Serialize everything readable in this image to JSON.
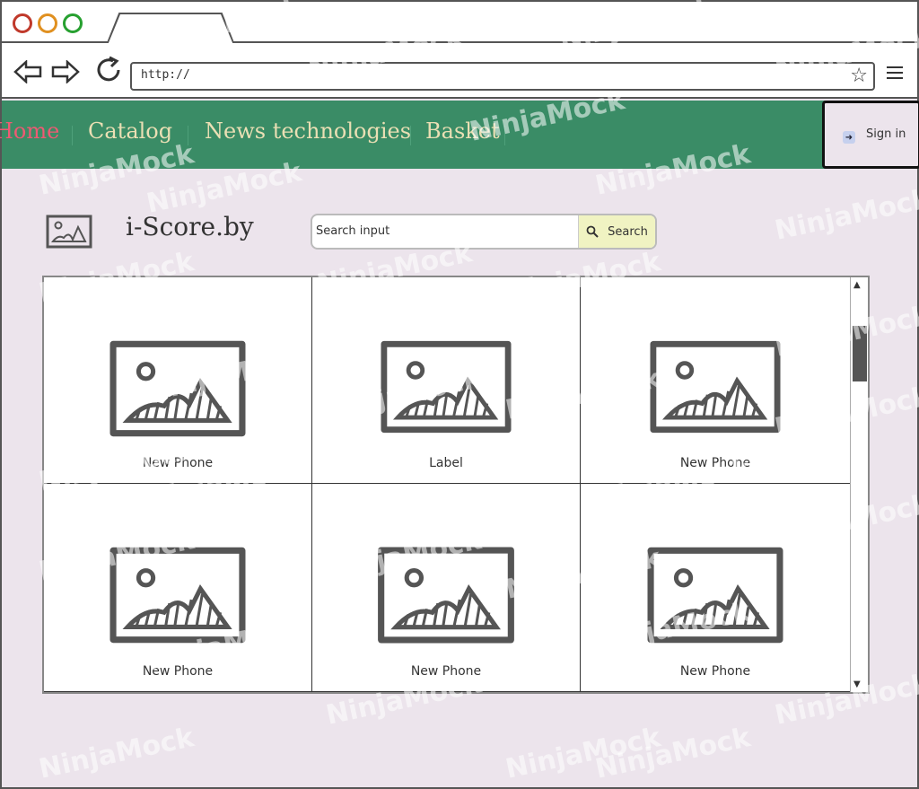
{
  "browser": {
    "url": "http://"
  },
  "site": {
    "nav": [
      {
        "label": "Home",
        "active": true
      },
      {
        "label": "Catalog"
      },
      {
        "label": "News technologies"
      },
      {
        "label": "Basket"
      }
    ],
    "sign_in": "Sign in",
    "brand": "i-Score.by"
  },
  "search": {
    "placeholder": "Search input",
    "button": "Search"
  },
  "products": [
    {
      "label": "New  Phone"
    },
    {
      "label": "Label"
    },
    {
      "label": "New Phone"
    },
    {
      "label": "New  Phone"
    },
    {
      "label": "New  Phone"
    },
    {
      "label": "New  Phone"
    }
  ],
  "watermark": "NinjaMock",
  "colors": {
    "nav_bg": "#3a8c66",
    "nav_text": "#eadfb4",
    "nav_active": "#ee5a73",
    "page_bg": "#ece4ec",
    "search_button": "#f0f3c2"
  }
}
